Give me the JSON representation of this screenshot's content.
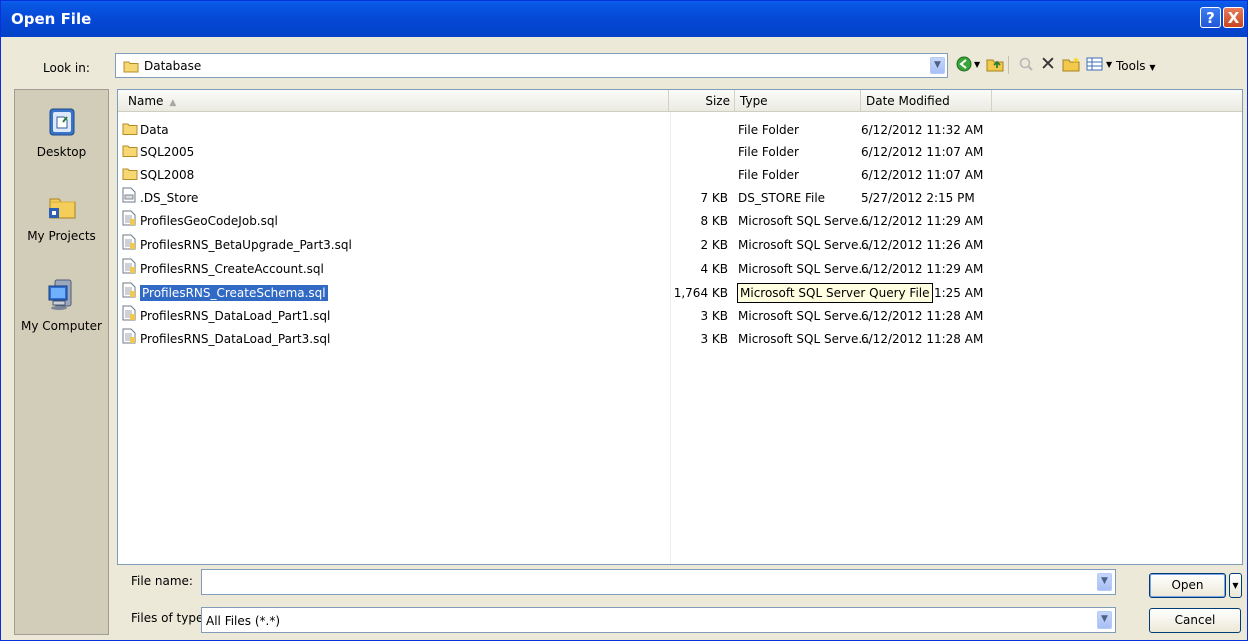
{
  "window": {
    "title": "Open File",
    "help_label": "?",
    "close_label": "X"
  },
  "lookin": {
    "label": "Look in:",
    "value": "Database"
  },
  "toolbar": {
    "tools_label": "Tools"
  },
  "places": [
    {
      "label": "Desktop",
      "icon": "desktop-icon"
    },
    {
      "label": "My Projects",
      "icon": "my-projects-icon"
    },
    {
      "label": "My Computer",
      "icon": "my-computer-icon"
    }
  ],
  "columns": {
    "name": "Name",
    "size": "Size",
    "type": "Type",
    "date": "Date Modified"
  },
  "files": [
    {
      "name": "Data",
      "size": "",
      "type": "File Folder",
      "date": "6/12/2012 11:32 AM",
      "icon": "folder-icon"
    },
    {
      "name": "SQL2005",
      "size": "",
      "type": "File Folder",
      "date": "6/12/2012 11:07 AM",
      "icon": "folder-icon"
    },
    {
      "name": "SQL2008",
      "size": "",
      "type": "File Folder",
      "date": "6/12/2012 11:07 AM",
      "icon": "folder-icon"
    },
    {
      "name": ".DS_Store",
      "size": "7 KB",
      "type": "DS_STORE File",
      "date": "5/27/2012 2:15 PM",
      "icon": "generic-file-icon"
    },
    {
      "name": "ProfilesGeoCodeJob.sql",
      "size": "8 KB",
      "type": "Microsoft SQL Serve...",
      "date": "6/12/2012 11:29 AM",
      "icon": "sql-file-icon"
    },
    {
      "name": "ProfilesRNS_BetaUpgrade_Part3.sql",
      "size": "2 KB",
      "type": "Microsoft SQL Serve...",
      "date": "6/12/2012 11:26 AM",
      "icon": "sql-file-icon"
    },
    {
      "name": "ProfilesRNS_CreateAccount.sql",
      "size": "4 KB",
      "type": "Microsoft SQL Serve...",
      "date": "6/12/2012 11:29 AM",
      "icon": "sql-file-icon"
    },
    {
      "name": "ProfilesRNS_CreateSchema.sql",
      "size": "1,764 KB",
      "type": "Microsoft SQL Serve...",
      "date": "6/12/2012 11:25 AM",
      "icon": "sql-file-icon",
      "selected": true
    },
    {
      "name": "ProfilesRNS_DataLoad_Part1.sql",
      "size": "3 KB",
      "type": "Microsoft SQL Serve...",
      "date": "6/12/2012 11:28 AM",
      "icon": "sql-file-icon"
    },
    {
      "name": "ProfilesRNS_DataLoad_Part3.sql",
      "size": "3 KB",
      "type": "Microsoft SQL Serve...",
      "date": "6/12/2012 11:28 AM",
      "icon": "sql-file-icon"
    }
  ],
  "tooltip": "Microsoft SQL Server Query File",
  "filename": {
    "label": "File name:",
    "value": ""
  },
  "filetype": {
    "label": "Files of type:",
    "value": "All Files (*.*)"
  },
  "buttons": {
    "open": "Open",
    "cancel": "Cancel"
  }
}
